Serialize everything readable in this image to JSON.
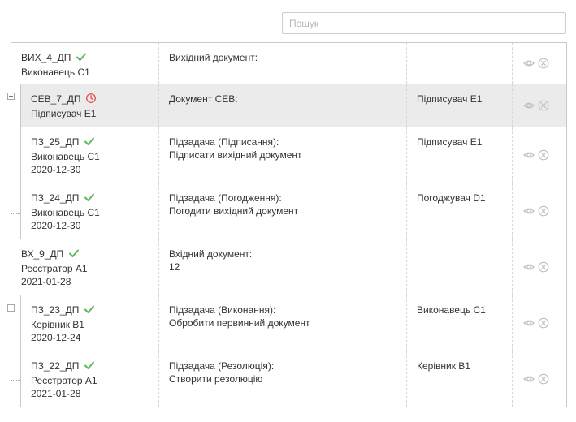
{
  "search": {
    "placeholder": "Пошук"
  },
  "rows": [
    {
      "code": "ВИХ_4_ДП",
      "status": "done",
      "person": "Виконавець С1",
      "date": "",
      "desc1": "Вихідний документ:",
      "desc2": "",
      "assignee": ""
    },
    {
      "code": "СЕВ_7_ДП",
      "status": "pending",
      "person": "Підписувач Е1",
      "date": "",
      "desc1": "Документ СЕВ:",
      "desc2": "",
      "assignee": "Підписувач Е1"
    },
    {
      "code": "ПЗ_25_ДП",
      "status": "done",
      "person": "Виконавець С1",
      "date": "2020-12-30",
      "desc1": "Підзадача (Підписання):",
      "desc2": "Підписати вихідний документ",
      "assignee": "Підписувач Е1"
    },
    {
      "code": "ПЗ_24_ДП",
      "status": "done",
      "person": "Виконавець С1",
      "date": "2020-12-30",
      "desc1": "Підзадача (Погодження):",
      "desc2": "Погодити вихідний документ",
      "assignee": "Погоджувач D1"
    },
    {
      "code": "ВХ_9_ДП",
      "status": "done",
      "person": "Реєстратор А1",
      "date": "2021-01-28",
      "desc1": "Вхідний документ:",
      "desc2": "12",
      "assignee": ""
    },
    {
      "code": "ПЗ_23_ДП",
      "status": "done",
      "person": "Керівник В1",
      "date": "2020-12-24",
      "desc1": "Підзадача (Виконання):",
      "desc2": "Обробити первинний документ",
      "assignee": "Виконавець С1"
    },
    {
      "code": "ПЗ_22_ДП",
      "status": "done",
      "person": "Реєстратор А1",
      "date": "2021-01-28",
      "desc1": "Підзадача (Резолюція):",
      "desc2": "Створити резолюцію",
      "assignee": "Керівник В1"
    }
  ],
  "colors": {
    "check": "#5cb85c",
    "clock": "#e05a4f",
    "icon": "#c2c2c2"
  },
  "icons": {
    "done": "check-icon",
    "pending": "clock-icon",
    "view": "eye-icon",
    "delete": "close-circle-icon"
  }
}
